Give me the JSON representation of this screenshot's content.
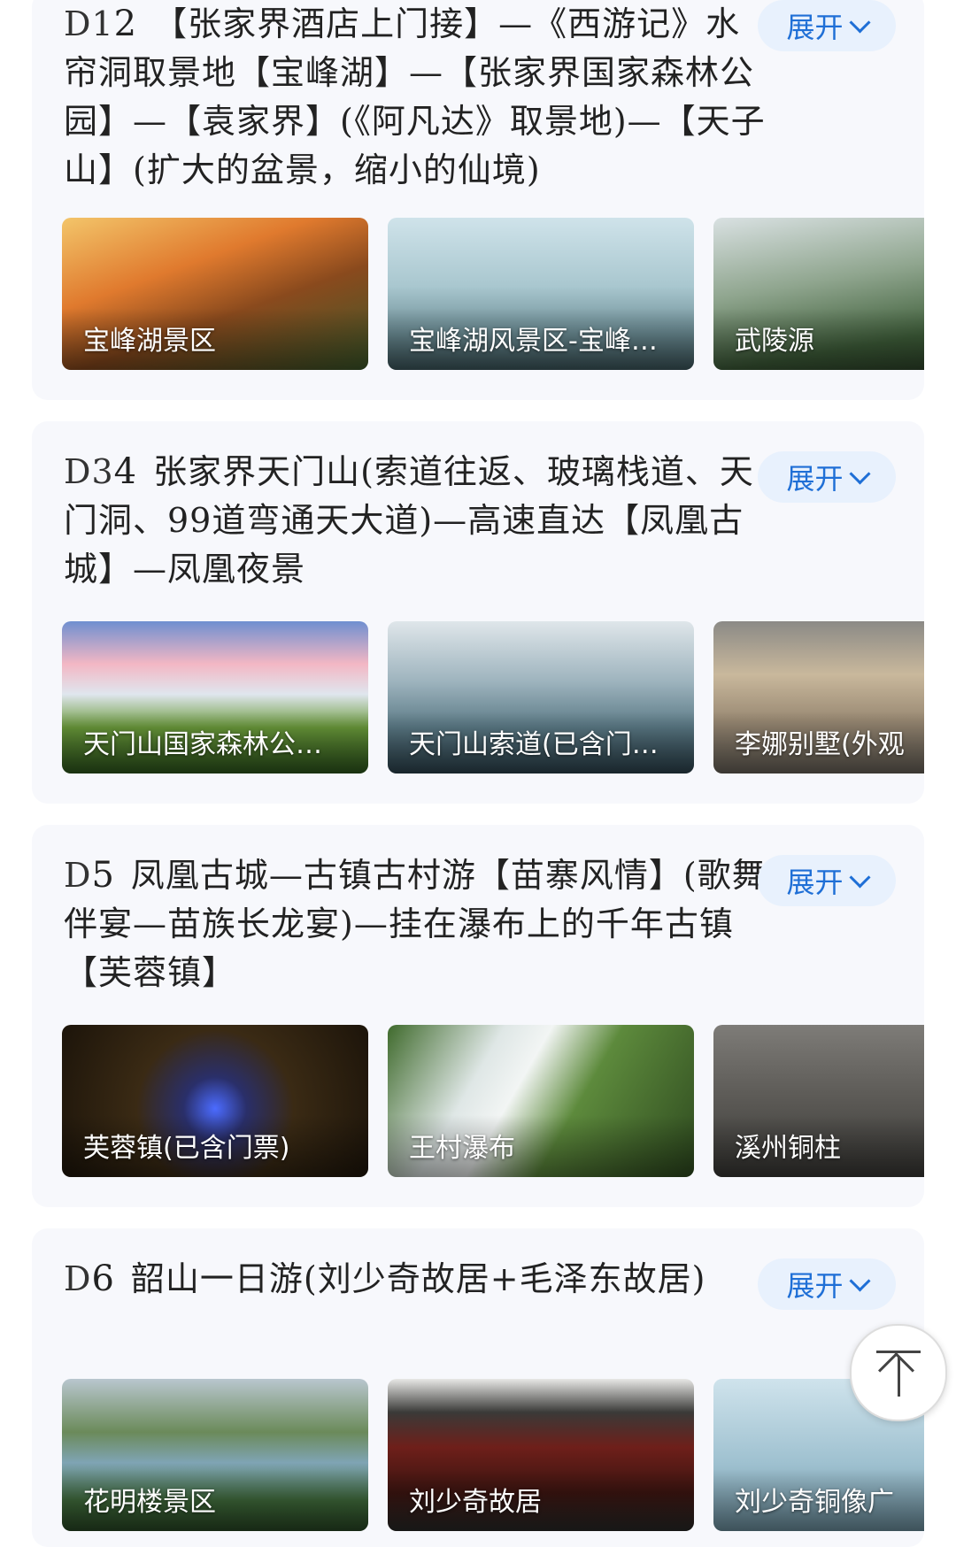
{
  "expand_label": "展开",
  "days": [
    {
      "tag": "D1",
      "num": "2",
      "title": "【张家界酒店上门接】—《西游记》水帘洞取景地【宝峰湖】—【张家界国家森林公园】—【袁家界】(《阿凡达》取景地)—【天子山】(扩大的盆景，缩小的仙境)",
      "thumbs": [
        "宝峰湖景区",
        "宝峰湖风景区-宝峰…",
        "武陵源"
      ]
    },
    {
      "tag": "D3",
      "num": "4",
      "title": "张家界天门山(索道往返、玻璃栈道、天门洞、99道弯通天大道)—高速直达【凤凰古城】—凤凰夜景",
      "thumbs": [
        "天门山国家森林公…",
        "天门山索道(已含门…",
        "李娜别墅(外观"
      ]
    },
    {
      "tag": "D",
      "num": "5",
      "title": "凤凰古城—古镇古村游【苗寨风情】(歌舞伴宴—苗族长龙宴)—挂在瀑布上的千年古镇【芙蓉镇】",
      "thumbs": [
        "芙蓉镇(已含门票)",
        "王村瀑布",
        "溪州铜柱"
      ]
    },
    {
      "tag": "D",
      "num": "6",
      "title": "韶山一日游(刘少奇故居+毛泽东故居)",
      "thumbs": [
        "花明楼景区",
        "刘少奇故居",
        "刘少奇铜像广"
      ]
    }
  ]
}
